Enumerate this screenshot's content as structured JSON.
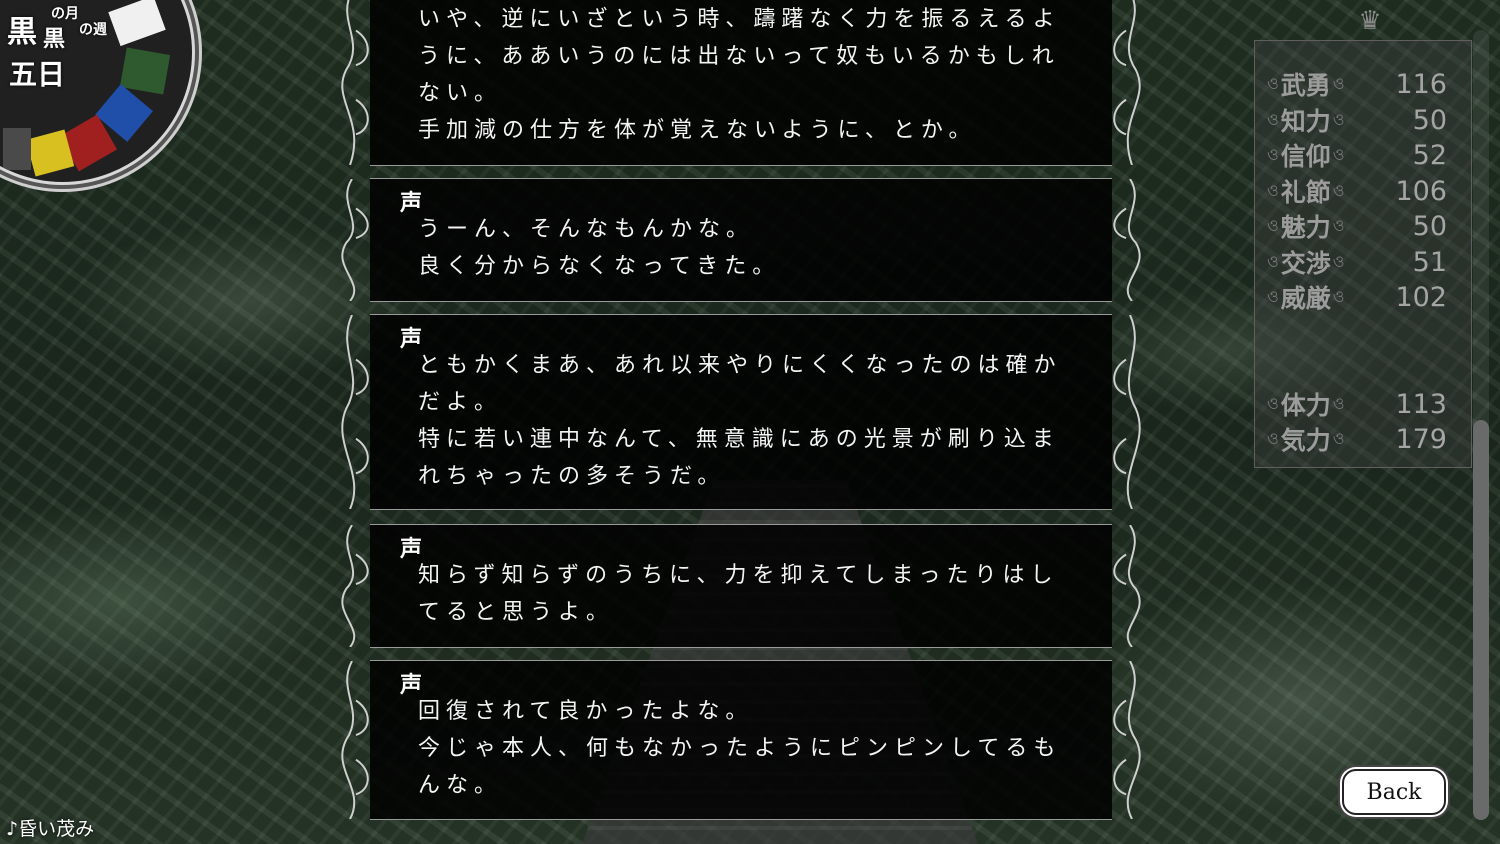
{
  "calendar": {
    "month_label": "の月",
    "kuro_large": "黒",
    "kuro_small": "黒",
    "week_label": "の週",
    "day_label": "五日",
    "colors": [
      "#ffffff",
      "#2f5a2f",
      "#1f4fa8",
      "#a02020",
      "#d8c020",
      "#3a3a3a"
    ]
  },
  "log": {
    "entries": [
      {
        "speaker": "",
        "lines": [
          "いや、逆にいざという時、躊躇なく力を振るえるよ",
          "うに、ああいうのには出ないって奴もいるかもしれ",
          "ない。",
          "手加減の仕方を体が覚えないように、とか。"
        ]
      },
      {
        "speaker": "声",
        "lines": [
          "うーん、そんなもんかな。",
          "良く分からなくなってきた。"
        ]
      },
      {
        "speaker": "声",
        "lines": [
          "ともかくまあ、あれ以来やりにくくなったのは確か",
          "だよ。",
          "特に若い連中なんて、無意識にあの光景が刷り込ま",
          "れちゃったの多そうだ。"
        ]
      },
      {
        "speaker": "声",
        "lines": [
          "知らず知らずのうちに、力を抑えてしまったりはし",
          "てると思うよ。"
        ]
      },
      {
        "speaker": "声",
        "lines": [
          "回復されて良かったよな。",
          "今じゃ本人、何もなかったようにピンピンしてるも",
          "んな。"
        ]
      }
    ]
  },
  "stats": {
    "items": [
      {
        "label": "武勇",
        "value": "116"
      },
      {
        "label": "知力",
        "value": "50"
      },
      {
        "label": "信仰",
        "value": "52"
      },
      {
        "label": "礼節",
        "value": "106"
      },
      {
        "label": "魅力",
        "value": "50"
      },
      {
        "label": "交渉",
        "value": "51"
      },
      {
        "label": "威厳",
        "value": "102"
      },
      {
        "label": "体力",
        "value": "113"
      },
      {
        "label": "気力",
        "value": "179"
      }
    ]
  },
  "back_button": {
    "label": "Back"
  },
  "bgm": {
    "title": "♪昏い茂み"
  }
}
